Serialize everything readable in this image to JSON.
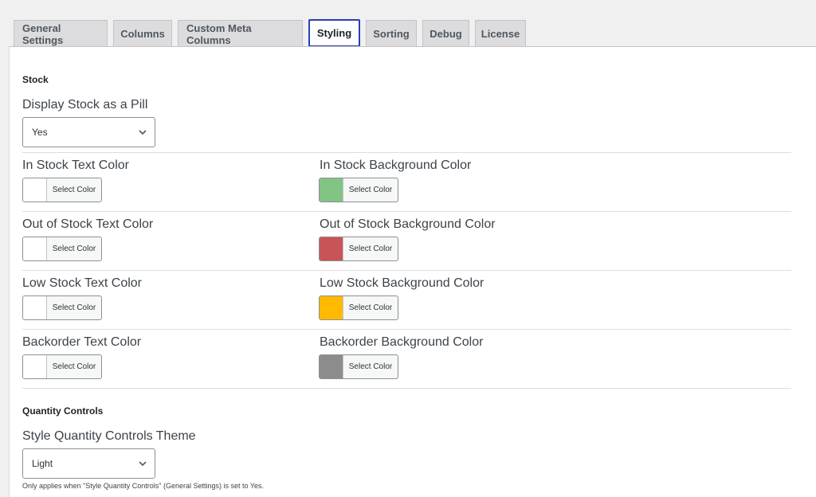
{
  "tabs": [
    {
      "label": "General Settings"
    },
    {
      "label": "Columns"
    },
    {
      "label": "Custom Meta Columns"
    },
    {
      "label": "Styling"
    },
    {
      "label": "Sorting"
    },
    {
      "label": "Debug"
    },
    {
      "label": "License"
    }
  ],
  "active_tab": "Styling",
  "stock": {
    "section_title": "Stock",
    "pill_label": "Display Stock as a Pill",
    "pill_value": "Yes",
    "rows": [
      {
        "text_label": "In Stock Text Color",
        "text_color": "#ffffff",
        "bg_label": "In Stock Background Color",
        "bg_color": "#82c483"
      },
      {
        "text_label": "Out of Stock Text Color",
        "text_color": "#ffffff",
        "bg_label": "Out of Stock Background Color",
        "bg_color": "#c95458"
      },
      {
        "text_label": "Low Stock Text Color",
        "text_color": "#ffffff",
        "bg_label": "Low Stock Background Color",
        "bg_color": "#ffb900"
      },
      {
        "text_label": "Backorder Text Color",
        "text_color": "#ffffff",
        "bg_label": "Backorder Background Color",
        "bg_color": "#8c8c8c"
      }
    ],
    "select_color_label": "Select Color"
  },
  "quantity": {
    "section_title": "Quantity Controls",
    "theme_label": "Style Quantity Controls Theme",
    "theme_value": "Light",
    "note": "Only applies when \"Style Quantity Controls\" (General Settings) is set to Yes."
  }
}
